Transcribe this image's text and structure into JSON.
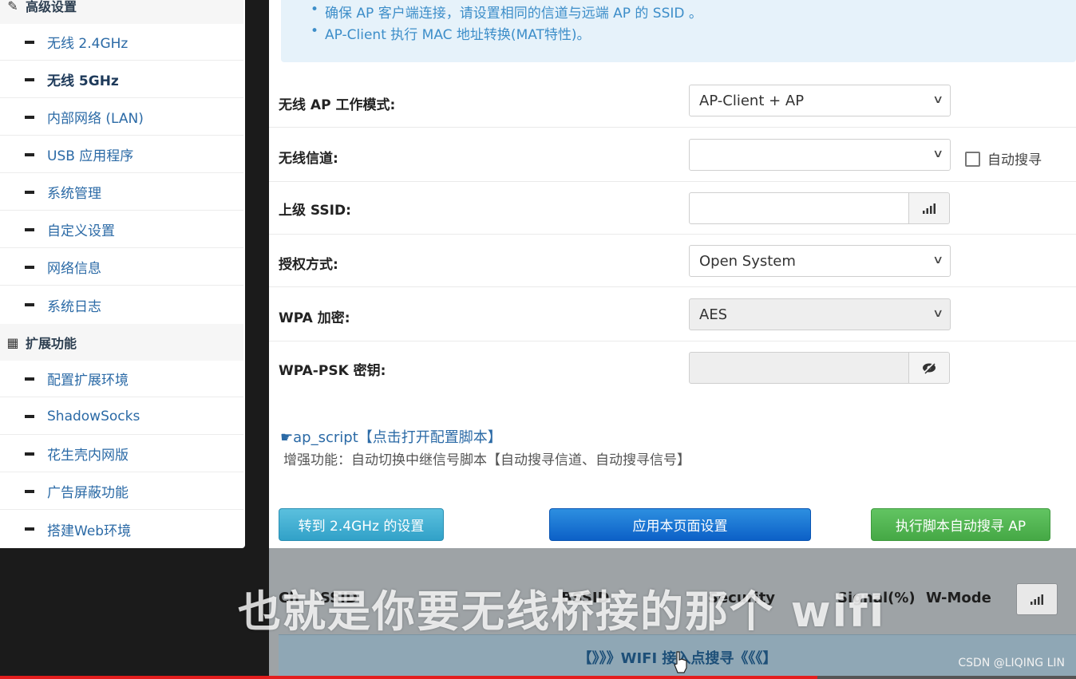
{
  "sidebar": {
    "sections": [
      {
        "title": "高级设置",
        "icon": "wrench-icon"
      },
      {
        "title": "扩展功能",
        "icon": "grid-icon"
      }
    ],
    "items": [
      {
        "label": "无线 2.4GHz",
        "active": false
      },
      {
        "label": "无线 5GHz",
        "active": true
      },
      {
        "label": "内部网络 (LAN)",
        "active": false
      },
      {
        "label": "USB 应用程序",
        "active": false
      },
      {
        "label": "系统管理",
        "active": false
      },
      {
        "label": "自定义设置",
        "active": false
      },
      {
        "label": "网络信息",
        "active": false
      },
      {
        "label": "系统日志",
        "active": false
      },
      {
        "label": "配置扩展环境",
        "active": false
      },
      {
        "label": "ShadowSocks",
        "active": false
      },
      {
        "label": "花生壳内网版",
        "active": false
      },
      {
        "label": "广告屏蔽功能",
        "active": false
      },
      {
        "label": "搭建Web环境",
        "active": false
      }
    ]
  },
  "info": {
    "lines": [
      "确保 AP 客户端连接，请设置相同的信道与远端 AP 的 SSID 。",
      "AP-Client 执行 MAC 地址转换(MAT特性)。"
    ]
  },
  "form": {
    "mode_label": "无线 AP 工作模式:",
    "mode_value": "AP-Client + AP",
    "channel_label": "无线信道:",
    "channel_value": "",
    "auto_search_label": "自动搜寻",
    "auto_search_checked": false,
    "ssid_label": "上级 SSID:",
    "ssid_value": "",
    "auth_label": "授权方式:",
    "auth_value": "Open System",
    "wpa_label": "WPA 加密:",
    "wpa_value": "AES",
    "psk_label": "WPA-PSK 密钥:",
    "psk_value": ""
  },
  "script": {
    "link": "ap_script【点击打开配置脚本】",
    "desc": "增强功能：自动切换中继信号脚本【自动搜寻信道、自动搜寻信号】"
  },
  "buttons": {
    "goto_24": "转到 2.4GHz 的设置",
    "apply": "应用本页面设置",
    "run_script": "执行脚本自动搜寻 AP"
  },
  "table": {
    "headers": [
      "Ch",
      "SSID",
      "BSSID",
      "Security",
      "Signal(%)",
      "W-Mode"
    ],
    "scan_label": "【》》》WIFI 接入点搜寻《《《】"
  },
  "overlay": {
    "subtitle": "也就是你要无线桥接的那个 wifi",
    "watermark": "CSDN @LIQING LIN",
    "progress": 0.76
  },
  "colors": {
    "link": "#2b6aa6",
    "info_bg": "#e6f2fa",
    "btn_cyan": "#5bc0de",
    "btn_blue": "#0c60c7",
    "btn_green": "#45a845",
    "progress": "#e41d1d"
  }
}
